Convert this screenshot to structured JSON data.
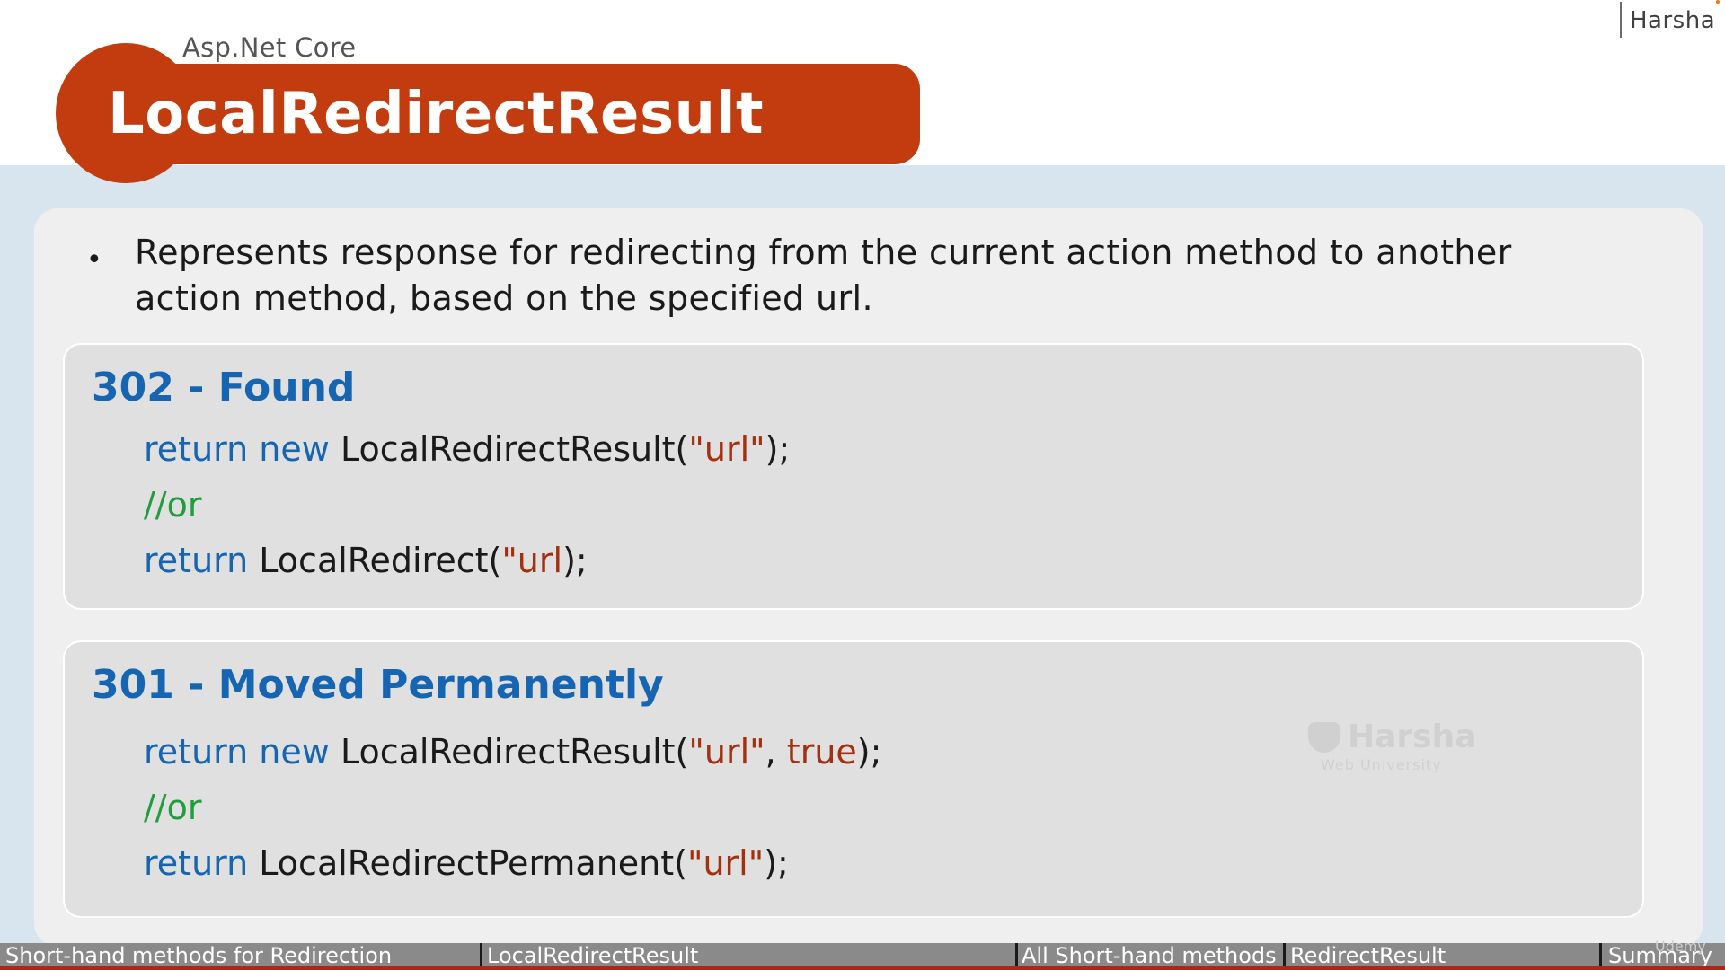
{
  "header": {
    "subtitle": "Asp.Net Core",
    "title": "LocalRedirectResult",
    "author": "Harsha"
  },
  "bullet": {
    "marker": "•",
    "text": "Represents response for redirecting from the current action method to another action method, based on the specified url."
  },
  "found_box": {
    "heading": "302 - Found",
    "line1": {
      "kw1": "return",
      "kw2": "new",
      "call": "LocalRedirectResult(",
      "str": "\"url\"",
      "end": ");"
    },
    "line2": {
      "comment": "//or"
    },
    "line3": {
      "kw": "return",
      "call": "LocalRedirect(",
      "str": "\"url",
      "end": ");"
    }
  },
  "permanent_box": {
    "heading": "301 - Moved Permanently",
    "line1": {
      "kw1": "return",
      "kw2": "new",
      "call": "LocalRedirectResult(",
      "str": "\"url\"",
      "comma": ", ",
      "bool": "true",
      "end": ");"
    },
    "line2": {
      "comment": "//or"
    },
    "line3": {
      "kw": "return",
      "call": "LocalRedirectPermanent(",
      "str": "\"url\"",
      "end": ");"
    }
  },
  "watermark": {
    "name": "Harsha",
    "sub": "Web University"
  },
  "nav": {
    "items": [
      "Short-hand methods for Redirection",
      "LocalRedirectResult",
      "All Short-hand methods",
      "RedirectResult",
      "Summary"
    ]
  },
  "udemy_mark": "Udemy",
  "colors": {
    "title_bg": "#c33c10",
    "keyword": "#1565b3",
    "string": "#a3300e",
    "comment": "#1e9e3c",
    "panel_bg": "#efefef",
    "code_box_bg": "#e0e0e0",
    "nav_bg": "#8a8a8a"
  }
}
